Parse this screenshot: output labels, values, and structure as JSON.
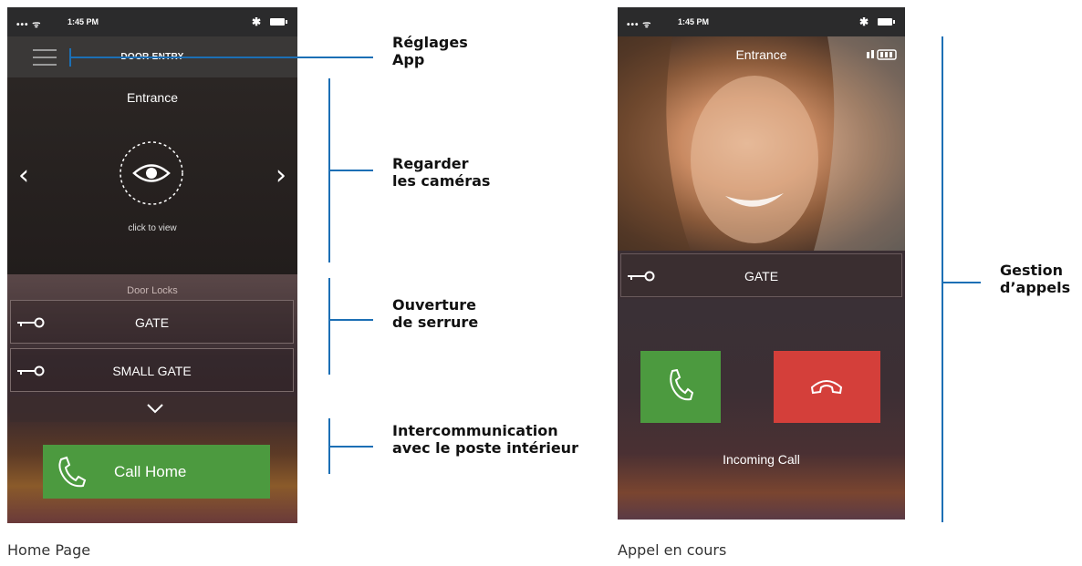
{
  "status_bar": {
    "signal": "••• ᯤ",
    "time": "1:45 PM",
    "bluetooth": "✱"
  },
  "home": {
    "nav_title": "DOOR ENTRY",
    "camera_title": "Entrance",
    "camera_hint": "click to view",
    "prev_arrow": "‹",
    "next_arrow": "›",
    "locks_title": "Door Locks",
    "locks": [
      {
        "label": "GATE"
      },
      {
        "label": "SMALL GATE"
      }
    ],
    "call_home_label": "Call Home"
  },
  "call": {
    "camera_title": "Entrance",
    "lock_label": "GATE",
    "status": "Incoming Call"
  },
  "annotations": {
    "settings": [
      "Réglages",
      "App"
    ],
    "cameras": [
      "Regarder",
      "les caméras"
    ],
    "locks": [
      "Ouverture",
      "de serrure"
    ],
    "intercom": [
      "Intercommunication",
      "avec le poste intérieur"
    ],
    "calls": [
      "Gestion",
      "d’appels"
    ]
  },
  "captions": {
    "home": "Home Page",
    "call": "Appel en cours"
  },
  "colors": {
    "accent_line": "#1c6fb5",
    "accept": "#4c9a3f",
    "decline": "#d43f3a"
  }
}
